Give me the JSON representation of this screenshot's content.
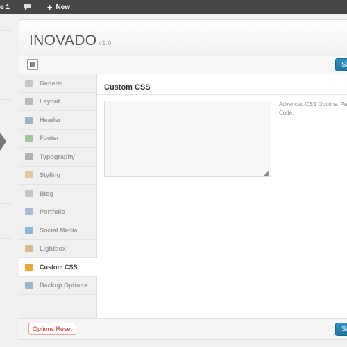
{
  "adminbar": {
    "updates_label": "e 1",
    "new_label": "New"
  },
  "header": {
    "brand": "INOVADO",
    "version": "v1.0"
  },
  "toolbar": {
    "save_label": "Sav"
  },
  "sidebar": {
    "items": [
      {
        "label": "General",
        "icon": "gear-icon",
        "color": "#c8c8c8"
      },
      {
        "label": "Layout",
        "icon": "layout-icon",
        "color": "#bbbbbb"
      },
      {
        "label": "Header",
        "icon": "header-icon",
        "color": "#9fb3c8"
      },
      {
        "label": "Footer",
        "icon": "footer-icon",
        "color": "#a8c3a0"
      },
      {
        "label": "Typography",
        "icon": "typography-icon",
        "color": "#b0b0b0"
      },
      {
        "label": "Styling",
        "icon": "styling-icon",
        "color": "#e6c79a"
      },
      {
        "label": "Blog",
        "icon": "blog-icon",
        "color": "#c5c5c5"
      },
      {
        "label": "Portfolio",
        "icon": "portfolio-icon",
        "color": "#a9bad4"
      },
      {
        "label": "Social Media",
        "icon": "social-icon",
        "color": "#8fb7d6"
      },
      {
        "label": "Lightbox",
        "icon": "lightbox-icon",
        "color": "#d8b98c"
      },
      {
        "label": "Custom CSS",
        "icon": "css-icon",
        "color": "#f0a830"
      },
      {
        "label": "Backup Options",
        "icon": "backup-icon",
        "color": "#9fb3c8"
      }
    ],
    "active_index": 10
  },
  "main": {
    "section_title": "Custom CSS",
    "textarea_value": "",
    "description": "Advanced CSS Options. Pas Code."
  },
  "footer": {
    "reset_label": "Options Reset",
    "save_label": "Sav"
  }
}
